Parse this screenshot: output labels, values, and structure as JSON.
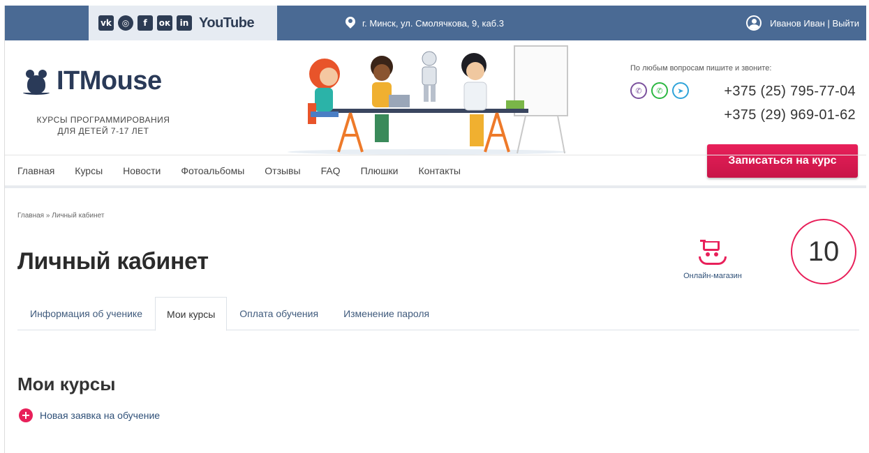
{
  "topbar": {
    "social": [
      {
        "name": "vk-icon",
        "glyph": "vk"
      },
      {
        "name": "instagram-icon",
        "glyph": "◎"
      },
      {
        "name": "facebook-icon",
        "glyph": "f"
      },
      {
        "name": "odnoklassniki-icon",
        "glyph": "ок"
      },
      {
        "name": "linkedin-icon",
        "glyph": "in"
      }
    ],
    "youtube_label": "YouTube",
    "address": "г. Минск, ул. Смолячкова, 9, каб.3",
    "user_label": "Иванов Иван | Выйти"
  },
  "header": {
    "logo_text": "ITMouse",
    "tagline_line1": "КУРСЫ ПРОГРАММИРОВАНИЯ",
    "tagline_line2": "ДЛЯ ДЕТЕЙ 7-17 ЛЕТ",
    "contact_note": "По любым вопросам пишите и звоните:",
    "phone1": "+375 (25) 795-77-04",
    "phone2": "+375 (29) 969-01-62",
    "enroll_button": "Записаться на курс"
  },
  "nav": {
    "items": [
      "Главная",
      "Курсы",
      "Новости",
      "Фотоальбомы",
      "Отзывы",
      "FAQ",
      "Плюшки",
      "Контакты"
    ]
  },
  "content": {
    "breadcrumb": "Главная » Личный кабинет",
    "page_title": "Личный кабинет",
    "shop_label": "Онлайн-магазин",
    "counter": "10",
    "tabs": [
      {
        "label": "Информация об ученике",
        "active": false
      },
      {
        "label": "Мои курсы",
        "active": true
      },
      {
        "label": "Оплата обучения",
        "active": false
      },
      {
        "label": "Изменение пароля",
        "active": false
      }
    ],
    "section_title": "Мои курсы",
    "new_request": "Новая заявка на обучение"
  },
  "colors": {
    "topbar": "#4a6a94",
    "accent": "#e8205a",
    "brand_dark": "#2a3a58"
  }
}
